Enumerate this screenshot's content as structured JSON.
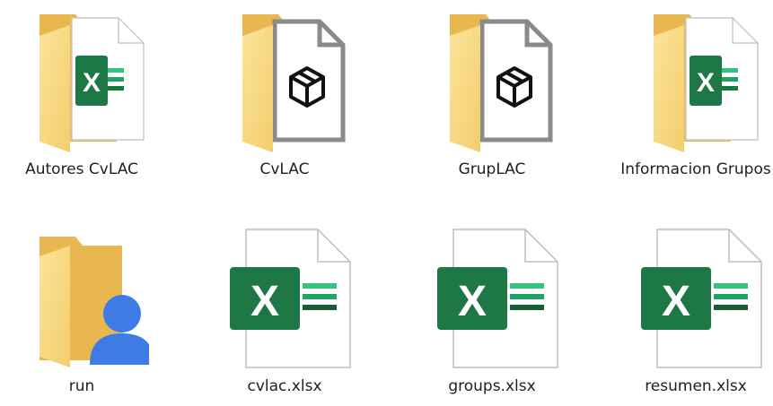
{
  "items": [
    {
      "label": "Autores CvLAC",
      "kind": "folder",
      "preview": "excel-icon"
    },
    {
      "label": "CvLAC",
      "kind": "folder",
      "preview": "3d-object-icon"
    },
    {
      "label": "GrupLAC",
      "kind": "folder",
      "preview": "3d-object-icon"
    },
    {
      "label": "Informacion Grupos",
      "kind": "folder",
      "preview": "excel-icon"
    },
    {
      "label": "run",
      "kind": "folder",
      "preview": "user-icon"
    },
    {
      "label": "cvlac.xlsx",
      "kind": "file",
      "preview": "excel-icon"
    },
    {
      "label": "groups.xlsx",
      "kind": "file",
      "preview": "excel-icon"
    },
    {
      "label": "resumen.xlsx",
      "kind": "file",
      "preview": "excel-icon"
    }
  ],
  "colors": {
    "folder_back": "#E9B74F",
    "folder_front": "#F8D77C",
    "excel_green": "#1D7845",
    "excel_grid": "#33C481",
    "user_blue": "#3E7BE6"
  }
}
